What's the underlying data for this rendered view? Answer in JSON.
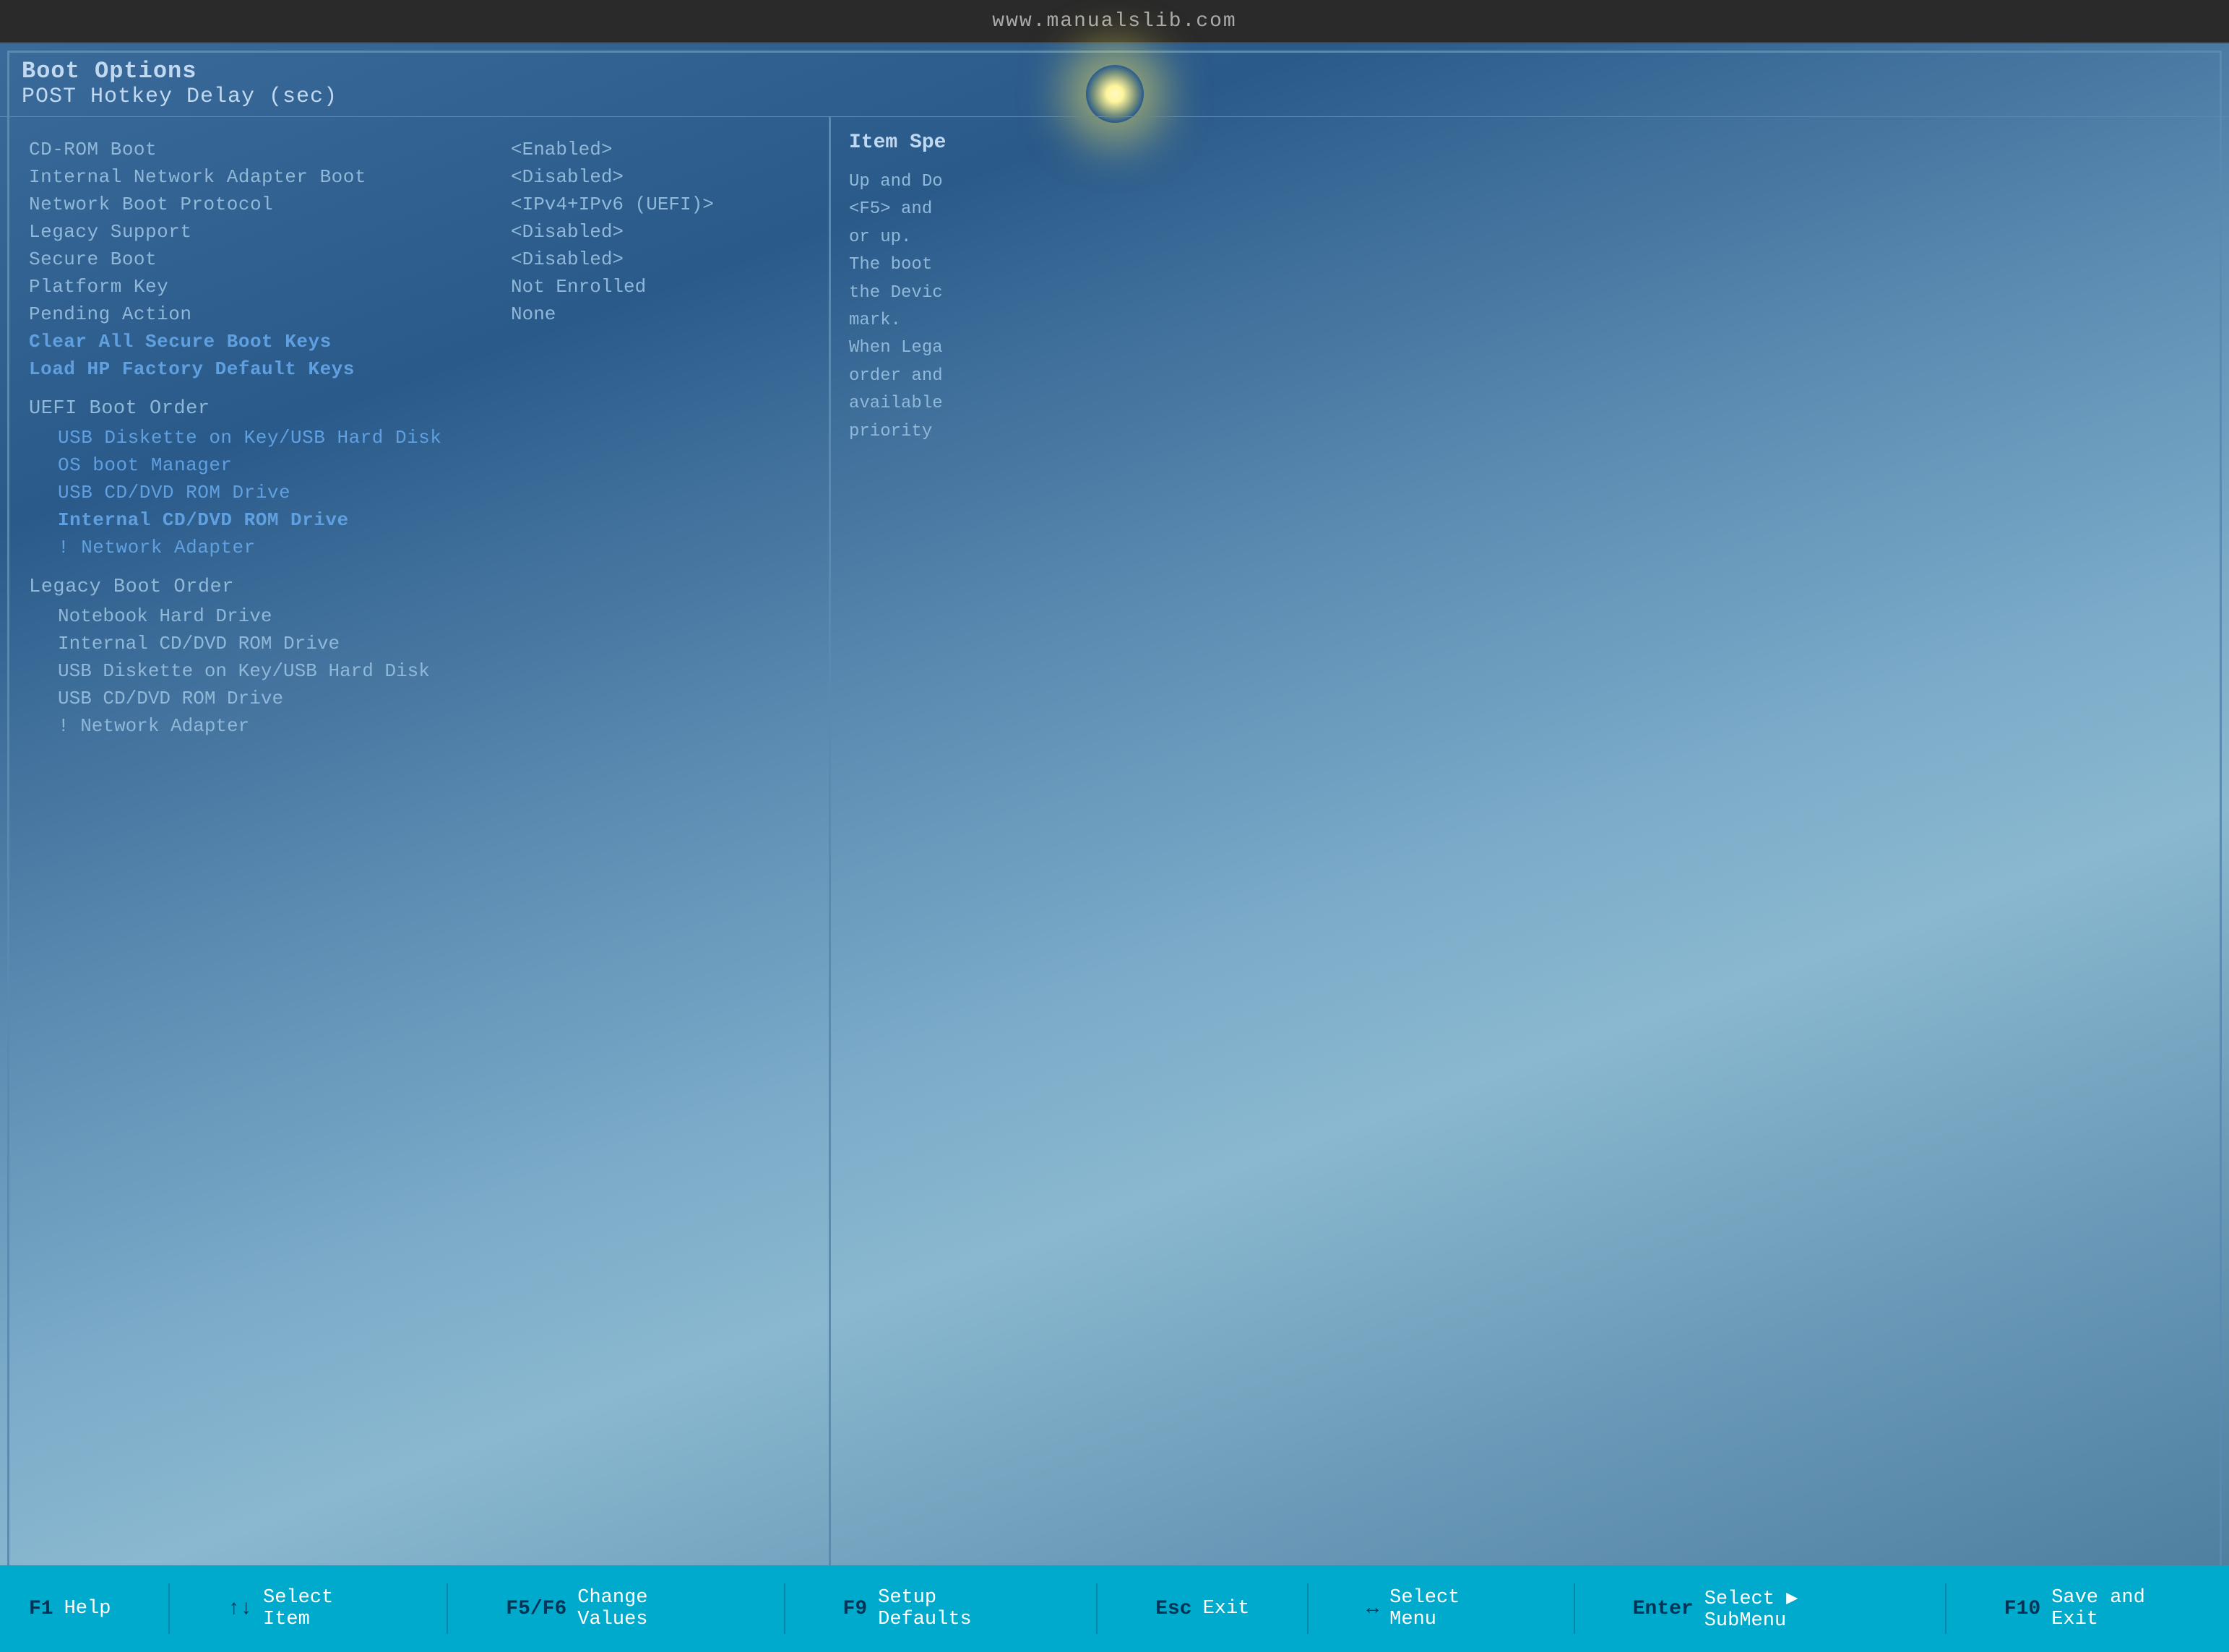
{
  "topbar": {
    "url": "www.manualslib.com"
  },
  "header": {
    "title": "Boot Options",
    "subtitle": "POST Hotkey Delay (sec)"
  },
  "rightPanel": {
    "title": "Item Spe",
    "lines": [
      "Up and Do",
      "<F5> and",
      "or up.",
      "The boot",
      "the Devic",
      "mark.",
      "When Lega",
      "order and",
      "available",
      "priority"
    ]
  },
  "settings": [
    {
      "label": "CD-ROM Boot",
      "value": "<Enabled>",
      "highlight": false
    },
    {
      "label": "Internal Network Adapter Boot",
      "value": "<Disabled>",
      "highlight": false
    },
    {
      "label": "Network Boot Protocol",
      "value": "<IPv4+IPv6 (UEFI)>",
      "highlight": false
    },
    {
      "label": "Legacy Support",
      "value": "<Disabled>",
      "highlight": false
    },
    {
      "label": "Secure Boot",
      "value": "<Disabled>",
      "highlight": false
    },
    {
      "label": "Platform Key",
      "value": "Not Enrolled",
      "highlight": false
    },
    {
      "label": "Pending Action",
      "value": "None",
      "highlight": false
    },
    {
      "label": "Clear All Secure Boot Keys",
      "value": "",
      "highlight": true
    },
    {
      "label": "Load HP Factory Default Keys",
      "value": "",
      "highlight": true
    }
  ],
  "uefiBootOrder": {
    "title": "UEFI Boot Order",
    "items": [
      "USB Diskette on Key/USB Hard Disk",
      "OS boot Manager",
      "USB CD/DVD ROM Drive",
      "Internal CD/DVD ROM Drive",
      "! Network Adapter"
    ]
  },
  "legacyBootOrder": {
    "title": "Legacy Boot Order",
    "items": [
      "Notebook Hard Drive",
      "Internal CD/DVD ROM Drive",
      "USB Diskette on Key/USB Hard Disk",
      "USB CD/DVD ROM Drive",
      "! Network Adapter"
    ]
  },
  "statusBar": {
    "items": [
      {
        "key": "F1",
        "desc": "Help"
      },
      {
        "key": "↑↓",
        "desc": "Select Item"
      },
      {
        "key": "F5/F6",
        "desc": "Change Values"
      },
      {
        "key": "F9",
        "desc": "Setup Defaults"
      },
      {
        "key": "Esc",
        "desc": "Exit"
      },
      {
        "key": "↔",
        "desc": "Select Menu"
      },
      {
        "key": "Enter",
        "desc": "Select ▶ SubMenu"
      },
      {
        "key": "F10",
        "desc": "Save and Exit"
      }
    ]
  }
}
